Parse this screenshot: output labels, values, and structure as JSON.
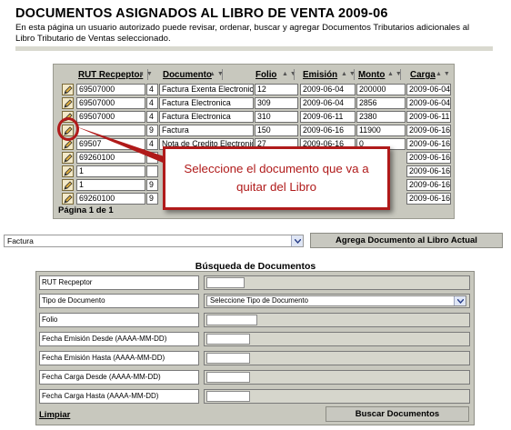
{
  "page": {
    "title": "DOCUMENTOS ASIGNADOS AL LIBRO DE VENTA 2009-06",
    "description": "En esta página un usuario autorizado puede revisar, ordenar, buscar y agregar Documentos Tributarios adicionales al Libro Tributario de Ventas seleccionado."
  },
  "grid": {
    "columns": [
      "RUT Recpeptor",
      "Documento",
      "Folio",
      "Emisión",
      "Monto",
      "Carga"
    ],
    "rows": [
      {
        "rut": "69507000",
        "tipo": "4",
        "documento": "Factura Exenta Electronica",
        "folio": "12",
        "emision": "2009-06-04",
        "monto": "200000",
        "carga": "2009-06-04"
      },
      {
        "rut": "69507000",
        "tipo": "4",
        "documento": "Factura Electronica",
        "folio": "309",
        "emision": "2009-06-04",
        "monto": "2856",
        "carga": "2009-06-04"
      },
      {
        "rut": "69507000",
        "tipo": "4",
        "documento": "Factura Electronica",
        "folio": "310",
        "emision": "2009-06-11",
        "monto": "2380",
        "carga": "2009-06-11"
      },
      {
        "rut": "",
        "tipo": "9",
        "documento": "Factura",
        "folio": "150",
        "emision": "2009-06-16",
        "monto": "11900",
        "carga": "2009-06-16"
      },
      {
        "rut": "69507",
        "tipo": "4",
        "documento": "Nota de Credito Electronica",
        "folio": "27",
        "emision": "2009-06-16",
        "monto": "0",
        "carga": "2009-06-16"
      },
      {
        "rut": "69260100",
        "tipo": "",
        "documento": "",
        "folio": "",
        "emision": "",
        "monto": "",
        "carga": "2009-06-16"
      },
      {
        "rut": "1",
        "tipo": "",
        "documento": "",
        "folio": "",
        "emision": "",
        "monto": "",
        "carga": "2009-06-16"
      },
      {
        "rut": "1",
        "tipo": "9",
        "documento": "",
        "folio": "",
        "emision": "",
        "monto": "",
        "carga": "2009-06-16"
      },
      {
        "rut": "69260100",
        "tipo": "9",
        "documento": "",
        "folio": "",
        "emision": "",
        "monto": "",
        "carga": "2009-06-16"
      }
    ],
    "pager": "Página 1 de 1"
  },
  "callout": {
    "line1": "Seleccione el documento que va a",
    "line2": "quitar del Libro"
  },
  "add": {
    "selected_document": "Factura",
    "button_label": "Agrega Documento al Libro Actual"
  },
  "search": {
    "title": "Búsqueda de Documentos",
    "fields": [
      {
        "label": "RUT Recpeptor",
        "value": ""
      },
      {
        "label": "Tipo de Documento",
        "value": "Seleccione Tipo de Documento"
      },
      {
        "label": "Folio",
        "value": ""
      },
      {
        "label": "Fecha Emisión Desde (AAAA-MM-DD)",
        "value": ""
      },
      {
        "label": "Fecha Emisión Hasta (AAAA-MM-DD)",
        "value": ""
      },
      {
        "label": "Fecha Carga Desde (AAAA-MM-DD)",
        "value": ""
      },
      {
        "label": "Fecha Carga Hasta (AAAA-MM-DD)",
        "value": ""
      }
    ],
    "clear_label": "Limpiar",
    "search_label": "Buscar Documentos"
  },
  "colors": {
    "panel": "#c8c8be",
    "callout": "#b01a1a"
  },
  "icons": {
    "edit": "pencil-edit-icon",
    "sort": "sort-arrows-icon",
    "dropdown": "chevron-down-icon"
  }
}
